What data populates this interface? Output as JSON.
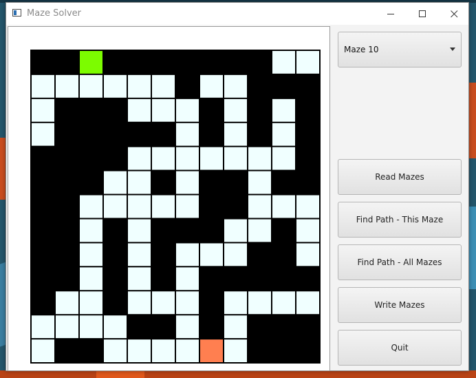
{
  "window": {
    "title": "Maze Solver"
  },
  "titlebar": {
    "minimize_icon": "minimize-icon",
    "maximize_icon": "maximize-icon",
    "close_icon": "close-icon"
  },
  "maze_selector": {
    "selected": "Maze 10"
  },
  "buttons": {
    "read": "Read Mazes",
    "find_this": "Find Path - This Maze",
    "find_all": "Find Path - All Mazes",
    "write": "Write Mazes",
    "quit": "Quit"
  },
  "maze": {
    "rows": 13,
    "cols": 12,
    "grid": [
      "##S#######..",
      "......#..###",
      ".###...#.#.#",
      ".#####.#.#.#",
      "####.......#",
      "###..#.##.##",
      "##.....##...",
      "##.#.###..#.",
      "##.#.#...##.",
      "##.#.#.#####",
      "#..#...#....",
      "....##.#.###",
      ".##....E.###"
    ],
    "colors": {
      "wall": "#000000",
      "open": "#f0ffff",
      "start": "#7cfc00",
      "end": "#ff7f50",
      "grid_line": "#000000"
    }
  }
}
